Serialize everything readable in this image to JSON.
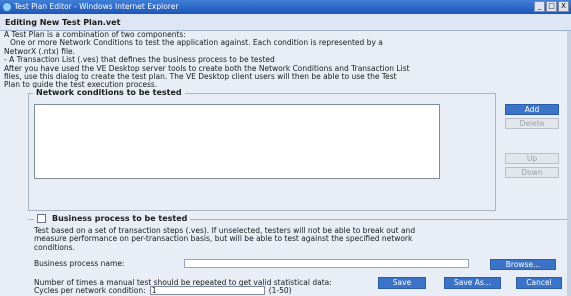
{
  "window": {
    "title": "Test Plan Editor - Windows Internet Explorer",
    "minimize": "_",
    "maximize": "□",
    "close": "X"
  },
  "header": {
    "title": "Editing New Test Plan.vet"
  },
  "intro": {
    "lines": [
      "A Test Plan is a combination of two components:",
      "One or more Network Conditions to test the application against. Each condition is represented by a",
      "NetworX (.ntx) file.",
      "- A Transaction List (.ves) that defines the business process to be tested",
      "After you have used the VE Desktop server tools to create both the Network Conditions and Transaction List",
      "files, use this dialog to create the test plan. The VE Desktop client users will then be able to use the Test",
      "Plan to guide the test execution process."
    ]
  },
  "network_conditions": {
    "legend": "Network conditions to be tested",
    "add_label": "Add",
    "delete_label": "Delete",
    "up_label": "Up",
    "down_label": "Down"
  },
  "business_process": {
    "checkbox_label": "Business process to be tested",
    "checked": false,
    "desc_lines": [
      "Test based on a set of transaction steps (.ves). If unselected, testers will not be able to break out and",
      "measure performance on per-transaction basis, but will be able to test against the specified network",
      "conditions."
    ],
    "name_label": "Business process name:",
    "name_value": "",
    "browse_label": "Browse..."
  },
  "repetition": {
    "line": "Number of times a manual test should be repeated to get valid statistical data:",
    "cycles_label": "Cycles per network condition:",
    "cycles_value": "1",
    "cycles_range": "(1-50)"
  },
  "footer": {
    "save_label": "Save",
    "save_as_label": "Save As...",
    "cancel_label": "Cancel"
  },
  "colors": {
    "accent": "#3b73c8",
    "titlebar": "#1f55b8"
  }
}
